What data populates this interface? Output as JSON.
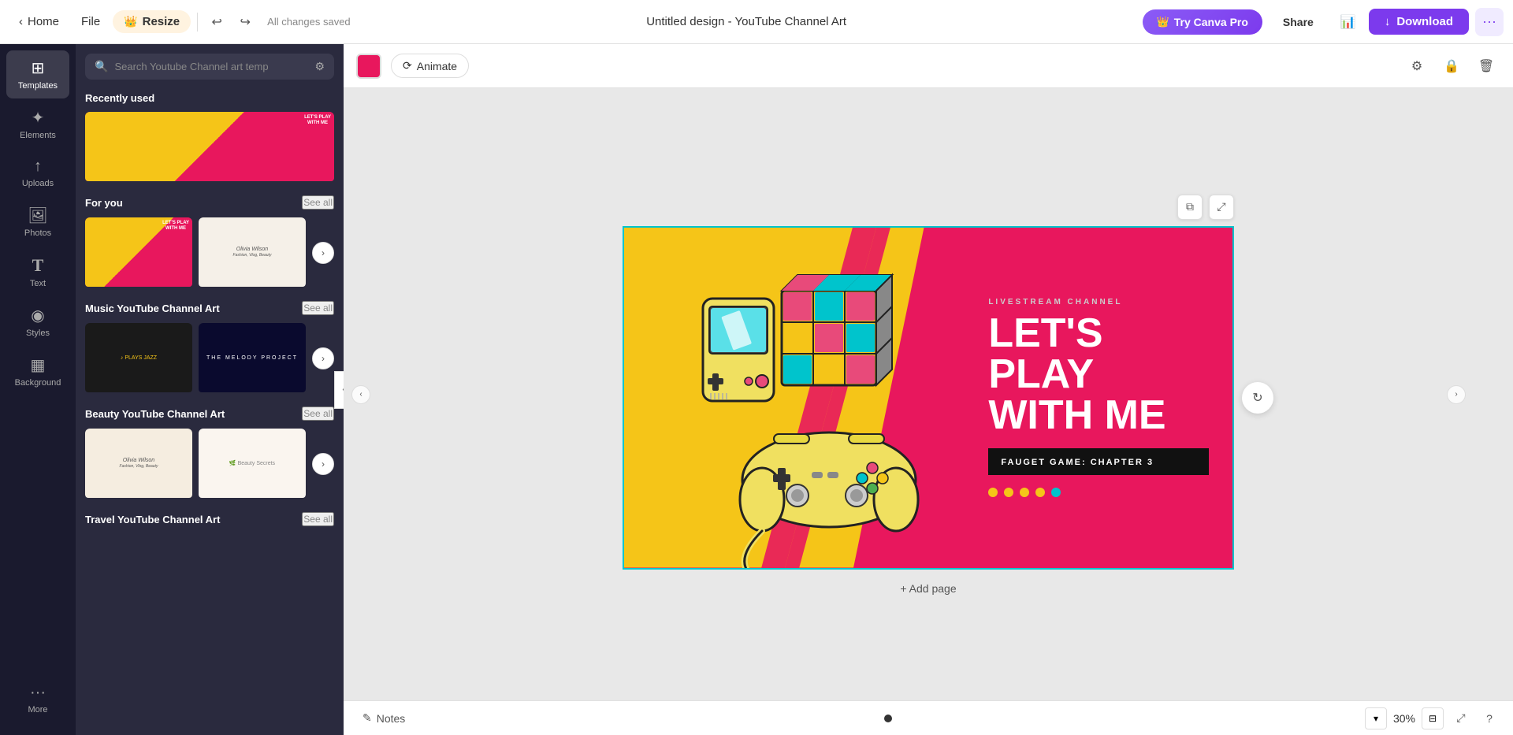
{
  "topbar": {
    "home_label": "Home",
    "file_label": "File",
    "resize_label": "Resize",
    "undo_symbol": "↩",
    "redo_symbol": "↪",
    "saved_status": "All changes saved",
    "doc_title": "Untitled design - YouTube Channel Art",
    "try_canva_label": "Try Canva Pro",
    "share_label": "Share",
    "download_label": "Download",
    "more_symbol": "···"
  },
  "sidebar": {
    "items": [
      {
        "id": "templates",
        "label": "Templates",
        "symbol": "⊞",
        "active": true
      },
      {
        "id": "elements",
        "label": "Elements",
        "symbol": "✦"
      },
      {
        "id": "uploads",
        "label": "Uploads",
        "symbol": "↑"
      },
      {
        "id": "photos",
        "label": "Photos",
        "symbol": "🖼"
      },
      {
        "id": "text",
        "label": "Text",
        "symbol": "T"
      },
      {
        "id": "styles",
        "label": "Styles",
        "symbol": "◉"
      },
      {
        "id": "background",
        "label": "Background",
        "symbol": "▦"
      },
      {
        "id": "more",
        "label": "More",
        "symbol": "···"
      }
    ]
  },
  "templates_panel": {
    "search_placeholder": "Search Youtube Channel art temp",
    "recently_used_title": "Recently used",
    "for_you_title": "For you",
    "see_all_label": "See all",
    "music_section_title": "Music YouTube Channel Art",
    "beauty_section_title": "Beauty YouTube Channel Art",
    "travel_section_title": "Travel YouTube Channel Art"
  },
  "canvas_toolbar": {
    "animate_label": "Animate",
    "animate_symbol": "⟳"
  },
  "design": {
    "livestream_label": "LIVESTREAM CHANNEL",
    "title_line1": "LET'S PLAY",
    "title_line2": "WITH ME",
    "subtitle": "FAUGET GAME: CHAPTER 3",
    "dots_count": 5
  },
  "bottom_bar": {
    "notes_label": "Notes",
    "zoom_level": "30%",
    "add_page_label": "+ Add page"
  },
  "canvas_corner": {
    "copy_symbol": "⧉",
    "expand_symbol": "⤢"
  }
}
